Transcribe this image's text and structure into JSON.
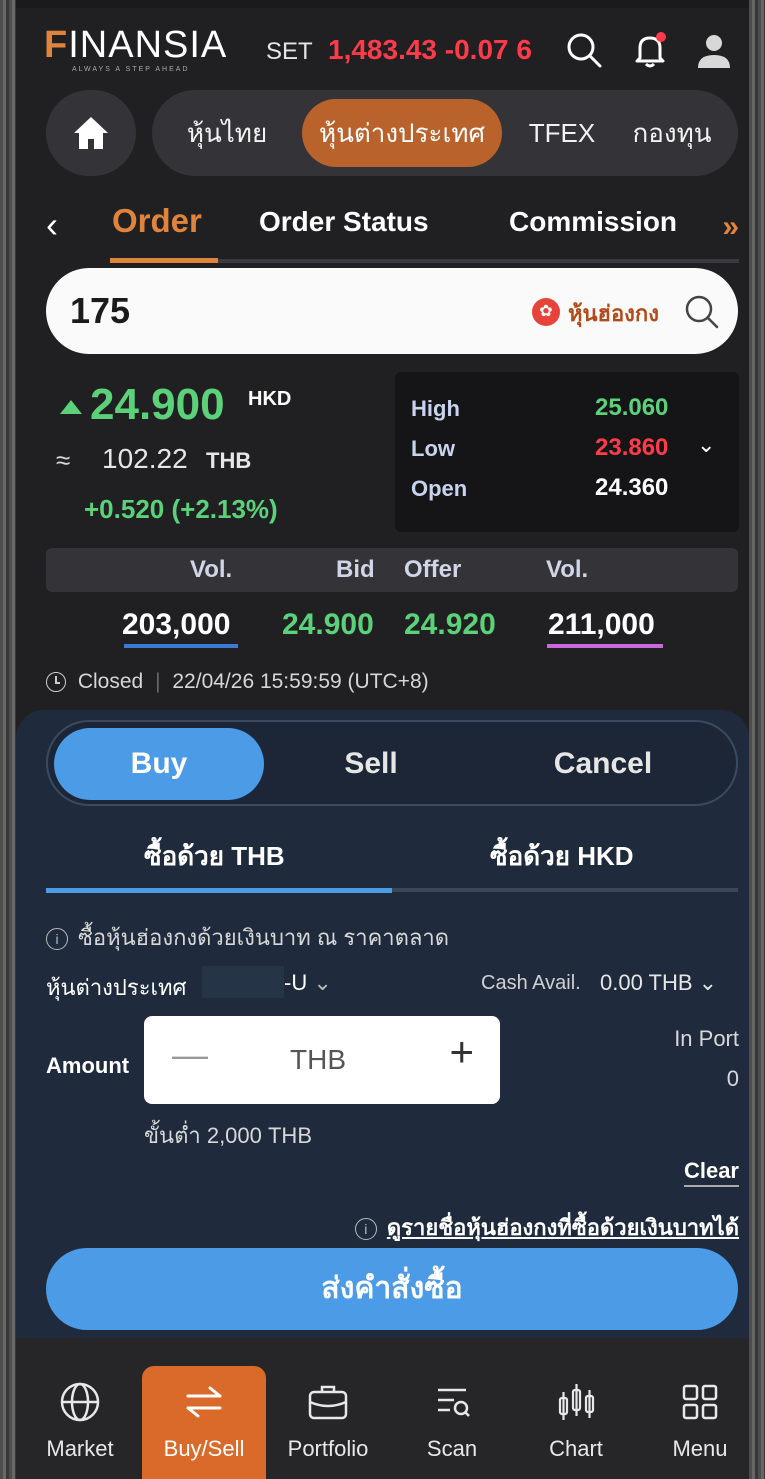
{
  "header": {
    "brand": "FINANSIA",
    "brand_first": "F",
    "brand_rest": "INANSIA",
    "tagline": "ALWAYS A STEP AHEAD",
    "index_label": "SET",
    "index_value": "1,483.43 -0.07 6",
    "icons": [
      "search-icon",
      "bell-icon",
      "user-icon"
    ]
  },
  "main_nav": {
    "home_icon": "home-icon",
    "items": [
      {
        "label": "หุ้นไทย"
      },
      {
        "label": "หุ้นต่างประเทศ",
        "active": true
      },
      {
        "label": "TFEX"
      },
      {
        "label": "กองทุน"
      }
    ]
  },
  "sub_tabs": {
    "items": [
      {
        "label": "Order",
        "active": true
      },
      {
        "label": "Order Status"
      },
      {
        "label": "Commission"
      }
    ],
    "more": "»"
  },
  "search": {
    "value": "175",
    "market_label": "หุ้นฮ่องกง"
  },
  "quote": {
    "price": "24.900",
    "currency": "HKD",
    "approx_symbol": "≈",
    "thb_value": "102.22",
    "thb_currency": "THB",
    "change": "+0.520 (+2.13%)",
    "high_label": "High",
    "high": "25.060",
    "low_label": "Low",
    "low": "23.860",
    "open_label": "Open",
    "open": "24.360"
  },
  "bid_offer": {
    "headers": [
      "Vol.",
      "Bid",
      "Offer",
      "Vol."
    ],
    "bid_vol": "203,000",
    "bid": "24.900",
    "offer": "24.920",
    "offer_vol": "211,000"
  },
  "status": {
    "state": "Closed",
    "timestamp": "22/04/26 15:59:59 (UTC+8)"
  },
  "trade": {
    "sides": [
      {
        "label": "Buy",
        "active": true
      },
      {
        "label": "Sell"
      },
      {
        "label": "Cancel"
      }
    ],
    "currency_tabs": [
      {
        "label": "ซื้อด้วย THB",
        "active": true
      },
      {
        "label": "ซื้อด้วย HKD"
      }
    ],
    "info": "ซื้อหุ้นฮ่องกงด้วยเงินบาท ณ ราคาตลาด",
    "account_label": "หุ้นต่างประเทศ",
    "account_suffix": "-U",
    "cash_label": "Cash Avail.",
    "cash_value": "0.00 THB",
    "amount_label": "Amount",
    "amount_unit": "THB",
    "minus": "—",
    "plus": "+",
    "in_port_label": "In Port",
    "in_port_value": "0",
    "minimum": "ขั้นต่ำ 2,000 THB",
    "clear": "Clear",
    "hk_list_link": "ดูรายชื่อหุ้นฮ่องกงที่ซื้อด้วยเงินบาทได้",
    "submit": "ส่งคำสั่งซื้อ"
  },
  "bottom_nav": [
    {
      "label": "Market",
      "icon": "globe-icon"
    },
    {
      "label": "Buy/Sell",
      "icon": "swap-icon",
      "active": true
    },
    {
      "label": "Portfolio",
      "icon": "briefcase-icon"
    },
    {
      "label": "Scan",
      "icon": "scan-icon"
    },
    {
      "label": "Chart",
      "icon": "candlestick-icon"
    },
    {
      "label": "Menu",
      "icon": "grid-icon"
    }
  ],
  "colors": {
    "accent_orange": "#e0843c",
    "up_green": "#5bd17a",
    "down_red": "#ff3b4a",
    "buy_blue": "#4c9be6"
  }
}
